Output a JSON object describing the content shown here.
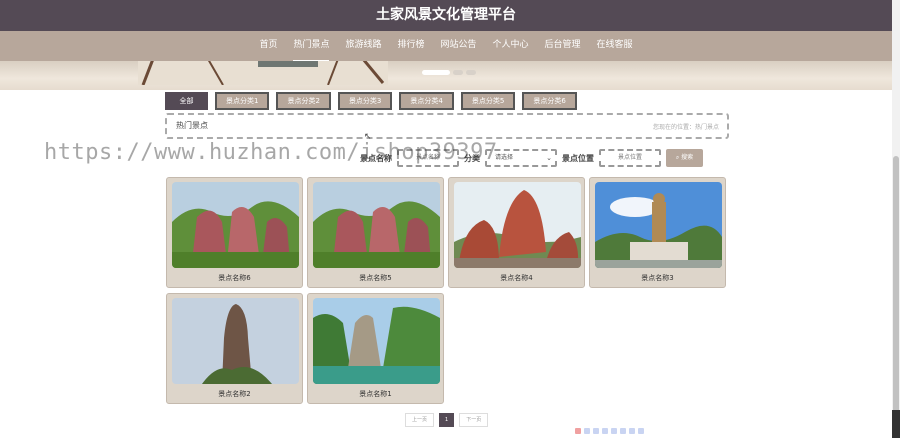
{
  "header": {
    "title": "土家风景文化管理平台"
  },
  "nav": {
    "items": [
      {
        "label": "首页",
        "active": false
      },
      {
        "label": "热门景点",
        "active": true
      },
      {
        "label": "旅游线路",
        "active": false
      },
      {
        "label": "排行榜",
        "active": false
      },
      {
        "label": "网站公告",
        "active": false
      },
      {
        "label": "个人中心",
        "active": false
      },
      {
        "label": "后台管理",
        "active": false
      },
      {
        "label": "在线客服",
        "active": false
      }
    ]
  },
  "tabs": [
    "全部",
    "景点分类1",
    "景点分类2",
    "景点分类3",
    "景点分类4",
    "景点分类5",
    "景点分类6"
  ],
  "section": {
    "title": "热门景点",
    "location": "您现在的位置：热门景点"
  },
  "search": {
    "name_label": "景点名称",
    "name_placeholder": "景点名称",
    "category_label": "分类",
    "category_value": "请选择",
    "position_label": "景点位置",
    "position_placeholder": "景点位置",
    "button_label": "搜索"
  },
  "cards": [
    {
      "name": "景点名称6",
      "image": "red-rock-mountains"
    },
    {
      "name": "景点名称5",
      "image": "red-rock-mountains"
    },
    {
      "name": "景点名称4",
      "image": "red-boulders-calligraphy"
    },
    {
      "name": "景点名称3",
      "image": "golden-buddha-statue"
    },
    {
      "name": "景点名称2",
      "image": "rock-pillar"
    },
    {
      "name": "景点名称1",
      "image": "green-cliffs-river"
    }
  ],
  "pager": {
    "prev": "上一页",
    "current": "1",
    "next": "下一页"
  },
  "watermark": "https://www.huzhan.com/ishop39397",
  "colors": {
    "header": "#544a55",
    "nav": "#b7a79b",
    "card": "#ddd5ca"
  }
}
